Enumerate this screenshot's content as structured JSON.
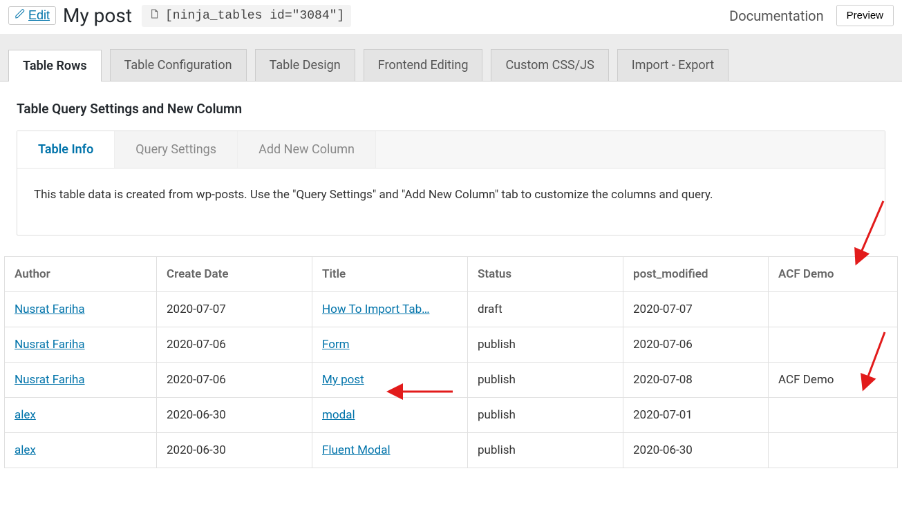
{
  "header": {
    "edit_label": "Edit",
    "page_title": "My post",
    "shortcode": "[ninja_tables id=\"3084\"]",
    "documentation_label": "Documentation",
    "preview_label": "Preview"
  },
  "main_tabs": [
    {
      "label": "Table Rows",
      "active": true
    },
    {
      "label": "Table Configuration",
      "active": false
    },
    {
      "label": "Table Design",
      "active": false
    },
    {
      "label": "Frontend Editing",
      "active": false
    },
    {
      "label": "Custom CSS/JS",
      "active": false
    },
    {
      "label": "Import - Export",
      "active": false
    }
  ],
  "section_title": "Table Query Settings and New Column",
  "sub_tabs": [
    {
      "label": "Table Info",
      "active": true
    },
    {
      "label": "Query Settings",
      "active": false
    },
    {
      "label": "Add New Column",
      "active": false
    }
  ],
  "table_info_text": "This table data is created from wp-posts. Use the \"Query Settings\" and \"Add New Column\" tab to customize the columns and query.",
  "columns": [
    {
      "label": "Author"
    },
    {
      "label": "Create Date"
    },
    {
      "label": "Title"
    },
    {
      "label": "Status"
    },
    {
      "label": "post_modified"
    },
    {
      "label": "ACF Demo"
    }
  ],
  "rows": [
    {
      "author": "Nusrat Fariha",
      "create_date": "2020-07-07",
      "title": "How To Import Tab…",
      "status": "draft",
      "post_modified": "2020-07-07",
      "acf_demo": ""
    },
    {
      "author": "Nusrat Fariha",
      "create_date": "2020-07-06",
      "title": "Form",
      "status": "publish",
      "post_modified": "2020-07-06",
      "acf_demo": ""
    },
    {
      "author": "Nusrat Fariha",
      "create_date": "2020-07-06",
      "title": "My post",
      "status": "publish",
      "post_modified": "2020-07-08",
      "acf_demo": "ACF Demo"
    },
    {
      "author": "alex",
      "create_date": "2020-06-30",
      "title": "modal",
      "status": "publish",
      "post_modified": "2020-07-01",
      "acf_demo": ""
    },
    {
      "author": "alex",
      "create_date": "2020-06-30",
      "title": "Fluent Modal",
      "status": "publish",
      "post_modified": "2020-06-30",
      "acf_demo": ""
    }
  ],
  "annotations": {
    "arrow_color": "#e21b1b"
  }
}
